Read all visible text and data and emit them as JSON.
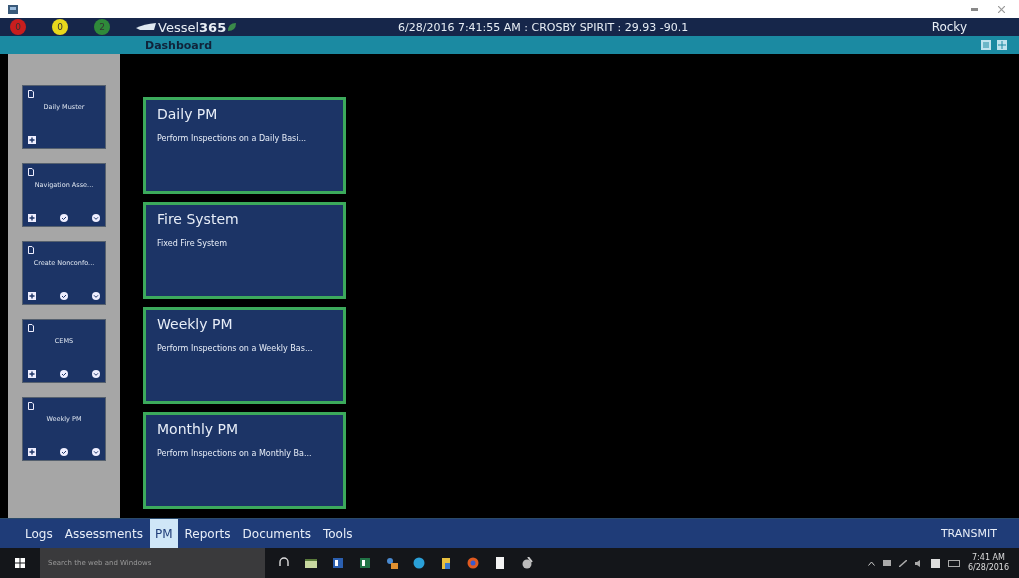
{
  "header": {
    "alerts": [
      {
        "count": "0",
        "color": "#c81e1e"
      },
      {
        "count": "0",
        "color": "#e8d81c"
      },
      {
        "count": "2",
        "color": "#2f8a3a"
      }
    ],
    "logo": {
      "name": "Vessel",
      "suffix": "365"
    },
    "status": "6/28/2016 7:41:55 AM : CROSBY SPIRIT : 29.93 -90.1",
    "user": "Rocky"
  },
  "subbar": {
    "title": "Dashboard"
  },
  "sidebar": {
    "items": [
      {
        "name": "Daily Muster",
        "actions": [
          {
            "kind": "add"
          }
        ]
      },
      {
        "name": "Navigation Asse...",
        "actions": [
          {
            "kind": "add"
          },
          {
            "kind": "check"
          },
          {
            "kind": "expand"
          }
        ]
      },
      {
        "name": "Create Nonconfo...",
        "actions": [
          {
            "kind": "add"
          },
          {
            "kind": "check"
          },
          {
            "kind": "expand"
          }
        ]
      },
      {
        "name": "CEMS",
        "actions": [
          {
            "kind": "add"
          },
          {
            "kind": "check"
          },
          {
            "kind": "expand"
          }
        ]
      },
      {
        "name": "Weekly PM",
        "actions": [
          {
            "kind": "add"
          },
          {
            "kind": "check"
          },
          {
            "kind": "expand"
          }
        ]
      }
    ]
  },
  "tiles": [
    {
      "title": "Daily PM",
      "description": "Perform Inspections on a Daily Basi..."
    },
    {
      "title": "Fire System",
      "description": "Fixed Fire System"
    },
    {
      "title": "Weekly PM",
      "description": "Perform Inspections on a Weekly Bas..."
    },
    {
      "title": "Monthly PM",
      "description": "Perform Inspections on a Monthly Ba..."
    }
  ],
  "nav": {
    "tabs": [
      {
        "label": "Logs",
        "selected": false
      },
      {
        "label": "Assessments",
        "selected": false
      },
      {
        "label": "PM",
        "selected": true
      },
      {
        "label": "Reports",
        "selected": false
      },
      {
        "label": "Documents",
        "selected": false
      },
      {
        "label": "Tools",
        "selected": false
      }
    ],
    "action": "TRANSMIT"
  },
  "taskbar": {
    "search_placeholder": "Search the web and Windows",
    "time": "7:41 AM",
    "date": "6/28/2016"
  }
}
